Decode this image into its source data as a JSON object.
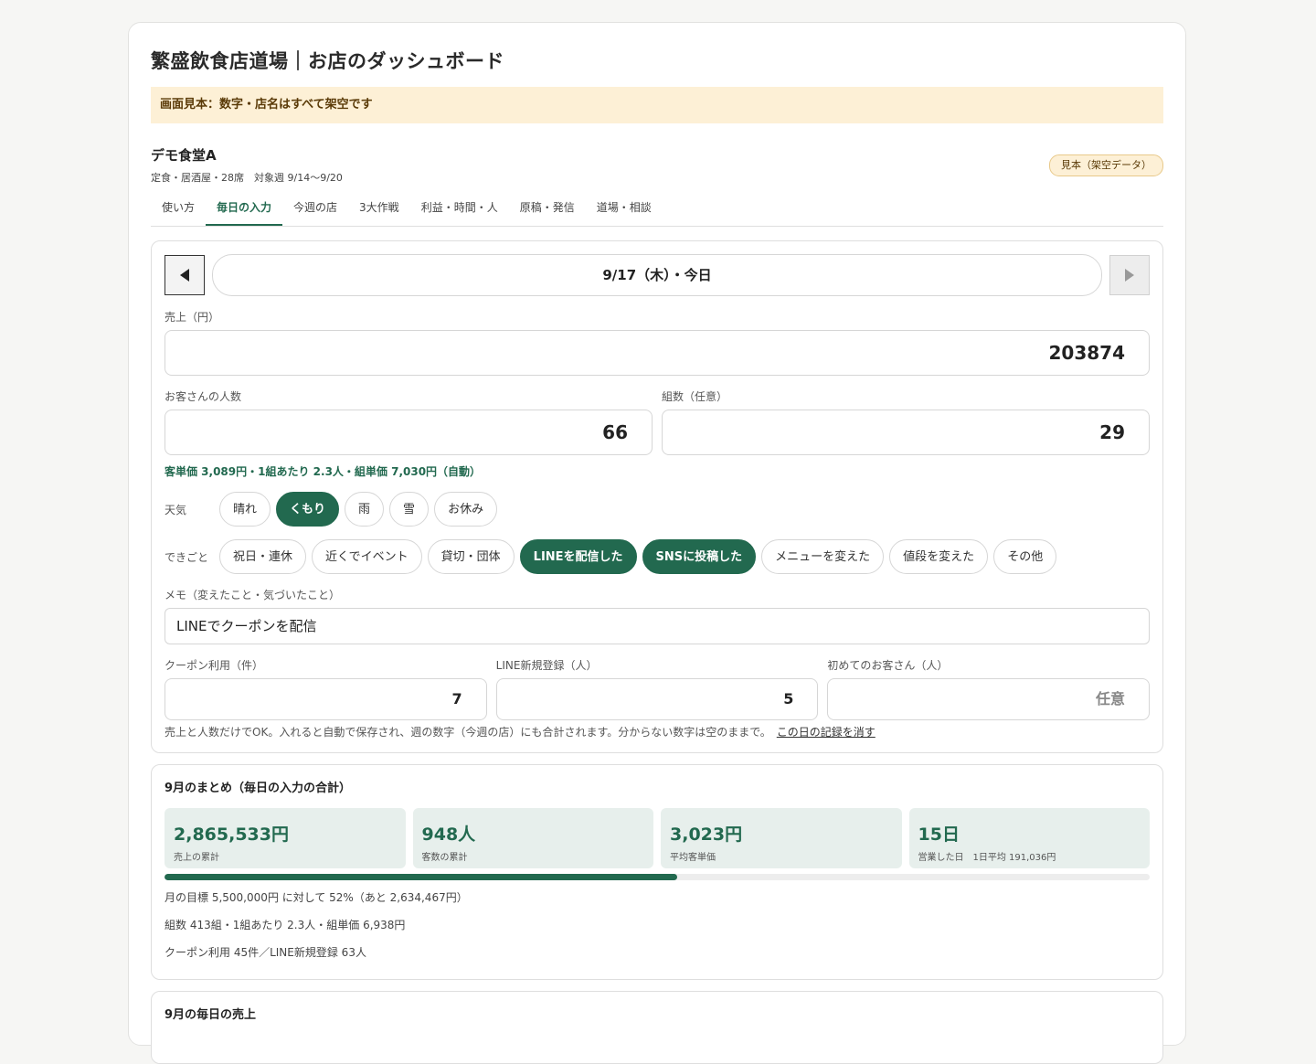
{
  "header": {
    "title": "繁盛飲食店道場｜お店のダッシュボード"
  },
  "notice": "画面見本：数字・店名はすべて架空です",
  "store": {
    "name": "デモ食堂A",
    "meta": "定食・居酒屋・28席　対象週 9/14〜9/20",
    "badge": "見本（架空データ）"
  },
  "tabs": [
    "使い方",
    "毎日の入力",
    "今週の店",
    "3大作戦",
    "利益・時間・人",
    "原稿・発信",
    "道場・相談"
  ],
  "active_tab": 1,
  "entry": {
    "date": "9/17（木）・今日",
    "sales_label": "売上（円）",
    "sales": "203874",
    "customers_label": "お客さんの人数",
    "customers": "66",
    "groups_label": "組数（任意）",
    "groups": "29",
    "calc": "客単価 3,089円・1組あたり 2.3人・組単価 7,030円（自動）",
    "weather_label": "天気",
    "weather": [
      {
        "label": "晴れ",
        "on": false
      },
      {
        "label": "くもり",
        "on": true
      },
      {
        "label": "雨",
        "on": false
      },
      {
        "label": "雪",
        "on": false
      },
      {
        "label": "お休み",
        "on": false
      }
    ],
    "events_label": "できごと",
    "events": [
      {
        "label": "祝日・連休",
        "on": false
      },
      {
        "label": "近くでイベント",
        "on": false
      },
      {
        "label": "貸切・団体",
        "on": false
      },
      {
        "label": "LINEを配信した",
        "on": true
      },
      {
        "label": "SNSに投稿した",
        "on": true
      },
      {
        "label": "メニューを変えた",
        "on": false
      },
      {
        "label": "値段を変えた",
        "on": false
      },
      {
        "label": "その他",
        "on": false
      }
    ],
    "memo_label": "メモ（変えたこと・気づいたこと）",
    "memo": "LINEでクーポンを配信",
    "coupon_label": "クーポン利用（件）",
    "coupon": "7",
    "line_label": "LINE新規登録（人）",
    "line": "5",
    "first_label": "初めてのお客さん（人）",
    "first_placeholder": "任意",
    "hint": "売上と人数だけでOK。入れると自動で保存され、週の数字（今週の店）にも合計されます。分からない数字は空のままで。",
    "clear_link": "この日の記録を消す"
  },
  "summary": {
    "title": "9月のまとめ（毎日の入力の合計）",
    "stats": [
      {
        "value": "2,865,533円",
        "label": "売上の累計"
      },
      {
        "value": "948人",
        "label": "客数の累計"
      },
      {
        "value": "3,023円",
        "label": "平均客単価"
      },
      {
        "value": "15日",
        "label": "営業した日　1日平均 191,036円"
      }
    ],
    "progress": 0.52,
    "goal_text": "月の目標 5,500,000円 に対して 52%（あと 2,634,467円）",
    "groups_text": "組数 413組・1組あたり 2.3人・組単価 6,938円",
    "coupon_text": "クーポン利用 45件／LINE新規登録 63人"
  },
  "daily": {
    "title": "9月の毎日の売上"
  },
  "colors": {
    "accent": "#22694f",
    "notice_bg": "#fdf0d6"
  }
}
